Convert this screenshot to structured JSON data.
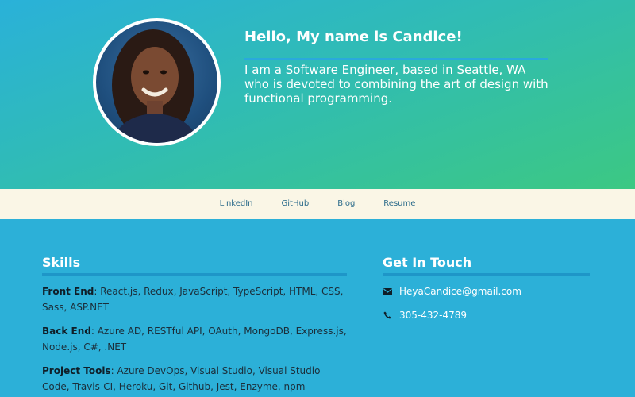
{
  "hero": {
    "greeting": "Hello, My name is Candice!",
    "bio": "I am a Software Engineer, based in Seattle, WA who is devoted to combining the art of design with functional programming."
  },
  "nav": {
    "items": [
      {
        "label": "LinkedIn"
      },
      {
        "label": "GitHub"
      },
      {
        "label": "Blog"
      },
      {
        "label": "Resume"
      }
    ]
  },
  "skills": {
    "title": "Skills",
    "rows": [
      {
        "label": "Front End",
        "value": "React.js, Redux, JavaScript, TypeScript, HTML, CSS, Sass, ASP.NET"
      },
      {
        "label": "Back End",
        "value": "Azure AD, RESTful API, OAuth, MongoDB, Express.js, Node.js, C#, .NET"
      },
      {
        "label": "Project Tools",
        "value": "Azure DevOps, Visual Studio, Visual Studio Code, Travis-CI, Heroku, Git, Github, Jest, Enzyme, npm"
      }
    ]
  },
  "contact": {
    "title": "Get In Touch",
    "email": "HeyaCandice@gmail.com",
    "phone": "305-432-4789",
    "email_icon": "envelope-icon",
    "phone_icon": "phone-icon"
  },
  "colors": {
    "accent": "#2cb0d8",
    "nav_bg": "#faf6e6",
    "gradient_end": "#3cc883"
  }
}
